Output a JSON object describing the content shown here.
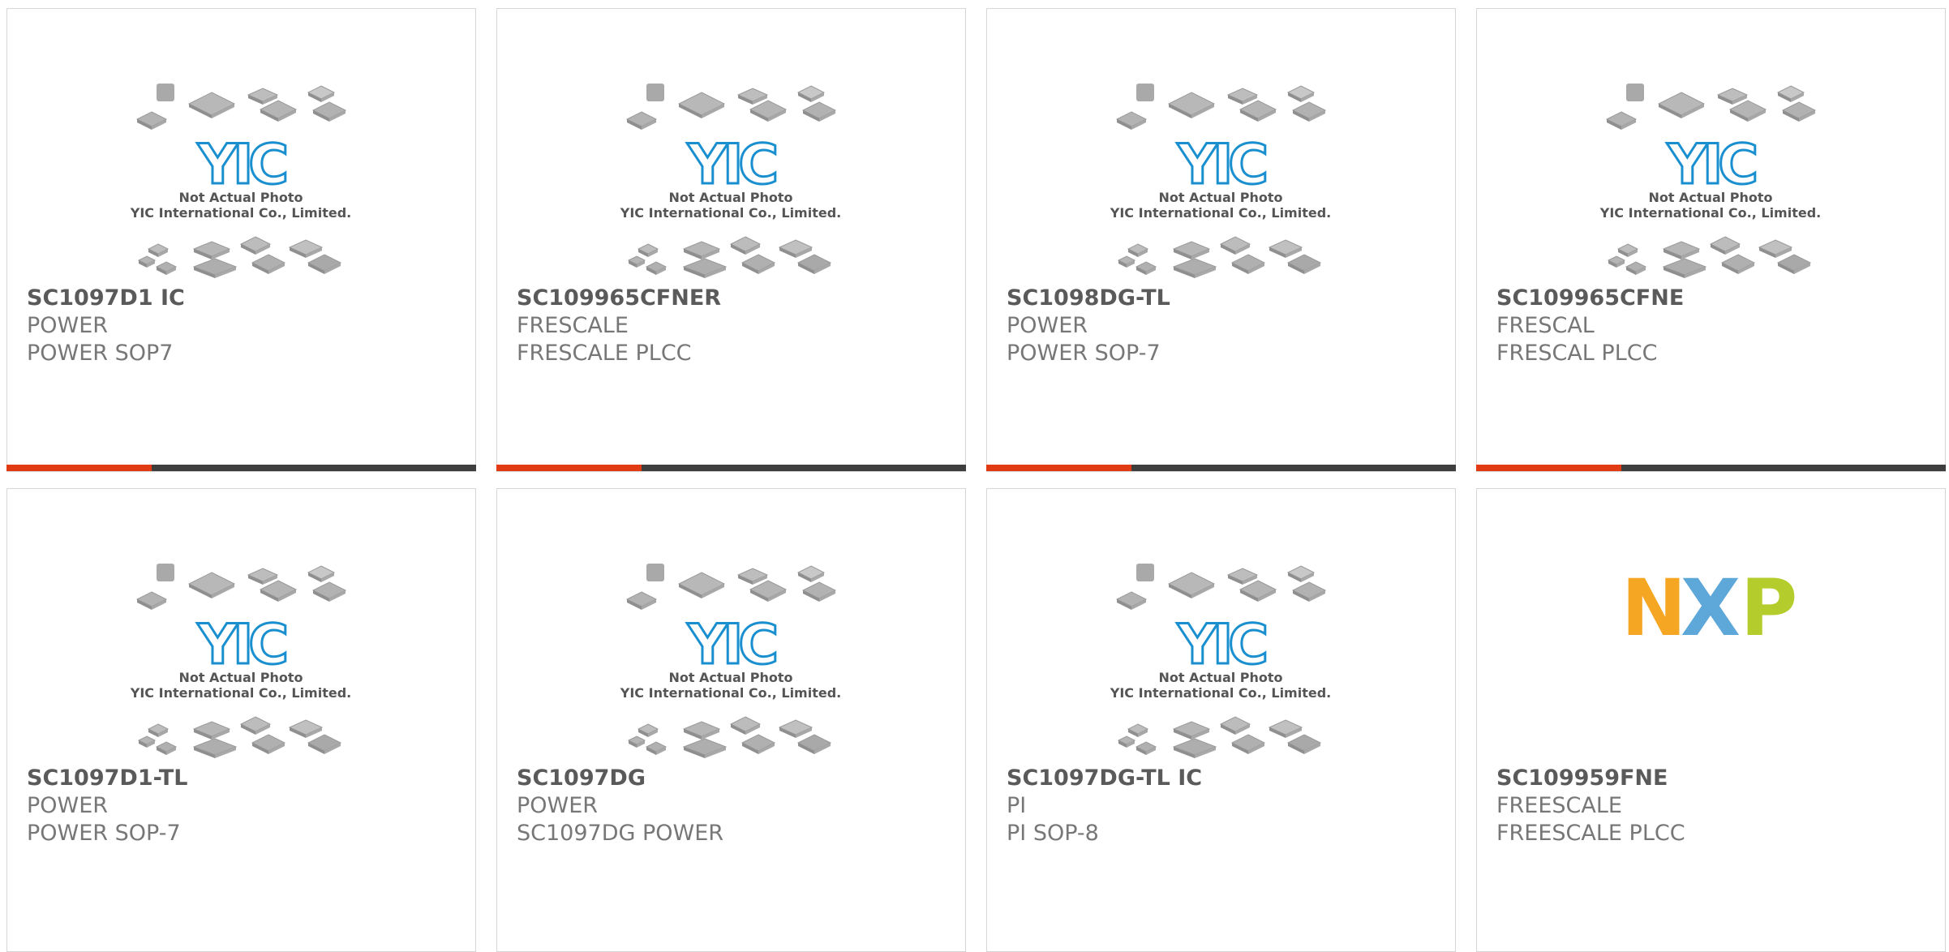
{
  "products": [
    {
      "part": "SC1097D1 IC",
      "brand": "POWER",
      "package": "POWER SOP7",
      "image": "yic-placeholder",
      "progress": 0.31
    },
    {
      "part": "SC109965CFNER",
      "brand": "FRESCALE",
      "package": "FRESCALE PLCC",
      "image": "yic-placeholder",
      "progress": 0.31
    },
    {
      "part": "SC1098DG-TL",
      "brand": "POWER",
      "package": "POWER SOP-7",
      "image": "yic-placeholder",
      "progress": 0.31
    },
    {
      "part": "SC109965CFNE",
      "brand": "FRESCAL",
      "package": "FRESCAL PLCC",
      "image": "yic-placeholder",
      "progress": 0.31
    },
    {
      "part": "SC1097D1-TL",
      "brand": "POWER",
      "package": "POWER SOP-7",
      "image": "yic-placeholder"
    },
    {
      "part": "SC1097DG",
      "brand": "POWER",
      "package": "SC1097DG POWER",
      "image": "yic-placeholder"
    },
    {
      "part": "SC1097DG-TL IC",
      "brand": "PI",
      "package": "PI SOP-8",
      "image": "yic-placeholder"
    },
    {
      "part": "SC109959FNE",
      "brand": "FREESCALE",
      "package": "FREESCALE PLCC",
      "image": "nxp-logo"
    }
  ],
  "placeholder": {
    "line1": "Not Actual Photo",
    "line2": "YIC International Co., Limited.",
    "logo_text": "YIC"
  },
  "nxp_logo_text": "NXP",
  "colors": {
    "progress_fill": "#e23a12",
    "progress_track": "#3e3e3e",
    "yic_blue": "#1a8fd0",
    "nxp_orange": "#f5a623",
    "nxp_blue": "#5da7d9",
    "nxp_green": "#b5cd2c"
  }
}
